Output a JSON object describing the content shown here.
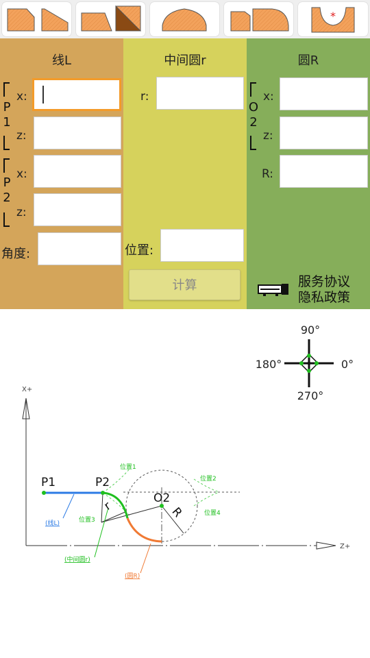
{
  "columns": {
    "line_title": "线L",
    "mid_title": "中间圆r",
    "circle_title": "圆R"
  },
  "line_panel": {
    "p1_label": "P1",
    "p2_label": "P2",
    "x_label": "x:",
    "z_label": "z:",
    "angle_label": "角度:",
    "p1_x": "",
    "p1_z": "",
    "p2_x": "",
    "p2_z": "",
    "angle": ""
  },
  "mid_panel": {
    "r_label": "r:",
    "position_label": "位置:",
    "r": "",
    "position": "",
    "calc_label": "计算"
  },
  "circle_panel": {
    "o2_label": "O2",
    "x_label": "x:",
    "z_label": "z:",
    "R_label": "R:",
    "x": "",
    "z": "",
    "R": ""
  },
  "links": {
    "service": "服务协议",
    "privacy": "隐私政策"
  },
  "compass": {
    "north": "90°",
    "west": "180°",
    "east": "0°",
    "south": "270°"
  },
  "diagram": {
    "x_axis": "X+",
    "z_axis": "Z+",
    "P1": "P1",
    "P2": "P2",
    "O2": "O2",
    "r": "r",
    "R": "R",
    "pos1": "位置1",
    "pos2": "位置2",
    "pos3": "位置3",
    "pos4": "位置4",
    "line_note": "(线L)",
    "mid_note": "(中间圆r)",
    "circle_note": "(圆R)"
  },
  "colors": {
    "line_col": "#d4a55a",
    "mid_col": "#d6d25c",
    "circle_col": "#86ae5a",
    "active_border": "#f39b2a",
    "line_blue": "#2c7be5",
    "arc_green": "#1fbf1f",
    "arc_orange": "#f07a34"
  }
}
